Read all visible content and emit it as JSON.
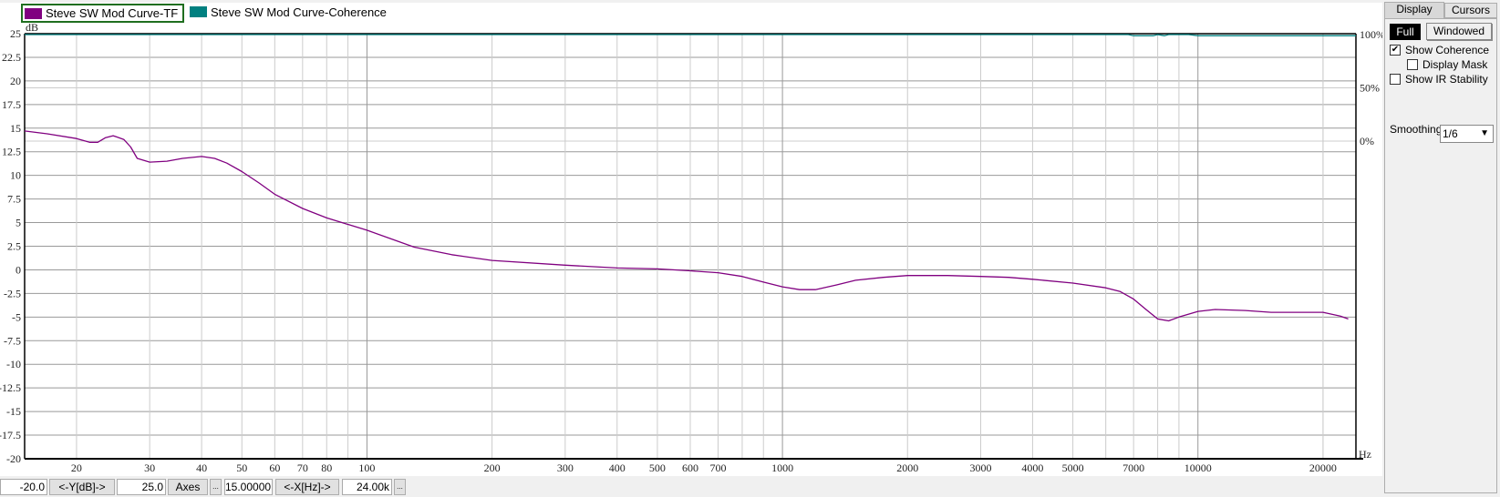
{
  "legend": {
    "tf": {
      "label": "Steve SW Mod Curve-TF",
      "color": "#800080"
    },
    "coherence": {
      "label": "Steve SW Mod Curve-Coherence",
      "color": "#008080"
    }
  },
  "chart_data": {
    "type": "line",
    "ylabel": "dB",
    "xlabel": "Hz",
    "x_scale": "log",
    "xlim": [
      15,
      24000
    ],
    "ylim": [
      -20,
      25
    ],
    "grid": true,
    "y_ticks": [
      "25",
      "22.5",
      "20",
      "17.5",
      "15",
      "12.5",
      "10",
      "7.5",
      "5",
      "2.5",
      "0",
      "-2.5",
      "-5",
      "-7.5",
      "-10",
      "-12.5",
      "-15",
      "-17.5",
      "-20"
    ],
    "x_ticks": [
      "20",
      "30",
      "40",
      "50",
      "60",
      "70",
      "80",
      "100",
      "200",
      "300",
      "400",
      "500",
      "600",
      "700",
      "1000",
      "2000",
      "3000",
      "4000",
      "5000",
      "7000",
      "10000",
      "20000"
    ],
    "right_axis": {
      "ticks": [
        "100%",
        "50%",
        "0%"
      ],
      "range": [
        0,
        100
      ]
    },
    "series": [
      {
        "name": "Steve SW Mod Curve-TF",
        "color": "#800080",
        "x": [
          15,
          17,
          20,
          21.5,
          22.5,
          23.5,
          24.5,
          26,
          27,
          28,
          30,
          33,
          36,
          40,
          43,
          46,
          50,
          55,
          60,
          70,
          80,
          100,
          130,
          160,
          200,
          300,
          400,
          500,
          600,
          700,
          800,
          900,
          1000,
          1100,
          1200,
          1350,
          1500,
          1750,
          2000,
          2500,
          3000,
          3500,
          4000,
          5000,
          6000,
          6500,
          7000,
          7500,
          8000,
          8500,
          9000,
          10000,
          11000,
          13000,
          15000,
          18000,
          20000,
          22000,
          23000
        ],
        "y": [
          14.7,
          14.4,
          13.9,
          13.5,
          13.5,
          14.0,
          14.2,
          13.8,
          13.0,
          11.8,
          11.4,
          11.5,
          11.8,
          12.0,
          11.8,
          11.3,
          10.4,
          9.2,
          8.0,
          6.5,
          5.5,
          4.2,
          2.4,
          1.6,
          1.0,
          0.5,
          0.2,
          0.1,
          -0.1,
          -0.3,
          -0.7,
          -1.3,
          -1.8,
          -2.1,
          -2.1,
          -1.6,
          -1.1,
          -0.8,
          -0.6,
          -0.6,
          -0.7,
          -0.8,
          -1.0,
          -1.4,
          -1.9,
          -2.3,
          -3.1,
          -4.2,
          -5.2,
          -5.4,
          -5.0,
          -4.4,
          -4.2,
          -4.3,
          -4.5,
          -4.5,
          -4.5,
          -4.9,
          -5.2
        ]
      },
      {
        "name": "Steve SW Mod Curve-Coherence",
        "color": "#008080",
        "x": [
          15,
          6800,
          7000,
          7800,
          8000,
          8300,
          8500,
          9500,
          10000,
          24000
        ],
        "y": [
          100,
          100,
          99,
          99,
          100,
          99,
          100,
          100,
          99,
          99
        ]
      }
    ]
  },
  "controls": {
    "y_min": "-20.0",
    "y_button": "<-Y[dB]->",
    "y_max": "25.0",
    "axes_button": "Axes",
    "more_y": "...",
    "x_min": "15.00000",
    "x_button": "<-X[Hz]->",
    "x_max": "24.00k",
    "more_x": "..."
  },
  "panel": {
    "tabs": [
      {
        "label": "Display",
        "active": true
      },
      {
        "label": "Cursors",
        "active": false
      }
    ],
    "full_label": "Full",
    "windowed_label": "Windowed",
    "show_coherence": {
      "label": "Show Coherence",
      "checked": true
    },
    "display_mask": {
      "label": "Display Mask",
      "checked": false
    },
    "show_ir_stability": {
      "label": "Show IR Stability",
      "checked": false
    },
    "smoothing_label": "Smoothing:",
    "smoothing_value": "1/6"
  }
}
